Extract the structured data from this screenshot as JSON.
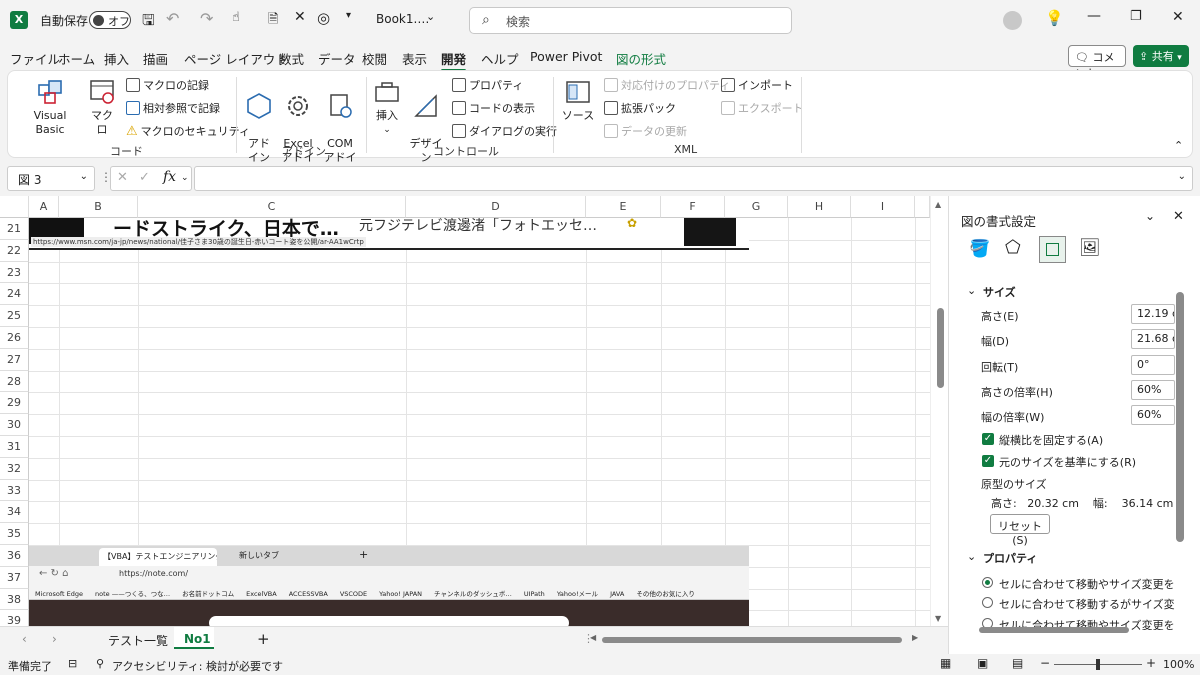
{
  "title_bar": {
    "autosave_label": "自動保存",
    "autosave_state": "オフ",
    "filename": "Book1.…",
    "search_placeholder": "検索"
  },
  "menu_tabs": [
    "ファイル",
    "ホーム",
    "挿入",
    "描画",
    "ページ レイアウト",
    "数式",
    "データ",
    "校閲",
    "表示",
    "開発",
    "ヘルプ",
    "Power Pivot",
    "図の形式"
  ],
  "active_tab": "開発",
  "comment_label": "コメント",
  "share_label": "共有",
  "ribbon": {
    "code": {
      "label": "コード",
      "visual_basic": "Visual Basic",
      "macro": "マクロ",
      "record_macro": "マクロの記録",
      "relative_ref": "相対参照で記録",
      "macro_security": "マクロのセキュリティ"
    },
    "addin": {
      "label": "アドイン",
      "addin": "アド\nイン",
      "excel_addin": "Excel\nアドイン",
      "com_addin": "COM\nアドイン"
    },
    "controls": {
      "label": "コントロール",
      "insert": "挿入",
      "design_mode": "デザイン\nモード",
      "properties": "プロパティ",
      "view_code": "コードの表示",
      "run_dialog": "ダイアログの実行"
    },
    "xml": {
      "label": "XML",
      "source": "ソース",
      "map_properties": "対応付けのプロパティ",
      "expansion_packs": "拡張パック",
      "refresh_data": "データの更新",
      "import": "インポート",
      "export": "エクスポート"
    }
  },
  "name_box": "図 3",
  "columns": [
    "A",
    "B",
    "C",
    "D",
    "E",
    "F",
    "G",
    "H",
    "I"
  ],
  "rows": [
    "21",
    "22",
    "23",
    "24",
    "25",
    "26",
    "27",
    "28",
    "29",
    "30",
    "31",
    "32",
    "33",
    "34",
    "35",
    "36",
    "37",
    "38",
    "39"
  ],
  "embedded_top": {
    "headline": "ードストライク、日本で…",
    "headline2": "元フジテレビ渡邊渚「フォトエッセ…",
    "url": "https://www.msn.com/ja-jp/news/national/佳子さま30歳の誕生日-赤いコート姿を公開/ar-AA1wCrtp"
  },
  "embedded_bottom": {
    "tab1": "【VBA】テストエンジニアリング】エビ",
    "tab2": "新しいタブ",
    "address": "https://note.com/",
    "bookmarks": [
      "Microsoft Edge",
      "note ——つくる、つな…",
      "お名前ドットコム",
      "ExcelVBA",
      "ACCESSVBA",
      "VSCODE",
      "Yahoo! JAPAN",
      "チャンネルのダッシュボ…",
      "UIPath",
      "Yahoo!メール",
      "JAVA",
      "その他のお気に入り"
    ]
  },
  "sheets": [
    "テスト一覧",
    "No1"
  ],
  "active_sheet": "No1",
  "status": {
    "ready": "準備完了",
    "accessibility": "アクセシビリティ: 検討が必要です",
    "zoom": "100%"
  },
  "pane": {
    "title": "図の書式設定",
    "size_section": "サイズ",
    "height_label": "高さ(E)",
    "height_value": "12.19 cm",
    "width_label": "幅(D)",
    "width_value": "21.68 cm",
    "rotation_label": "回転(T)",
    "rotation_value": "0°",
    "scale_h_label": "高さの倍率(H)",
    "scale_h_value": "60%",
    "scale_w_label": "幅の倍率(W)",
    "scale_w_value": "60%",
    "lock_aspect": "縦横比を固定する(A)",
    "relative_original": "元のサイズを基準にする(R)",
    "original_size_label": "原型のサイズ",
    "original_size_value": "高さ:   20.32 cm    幅:    36.14 cm",
    "reset_button": "リセット(S)",
    "properties_section": "プロパティ",
    "prop_opt1": "セルに合わせて移動やサイズ変更をする(S)",
    "prop_opt2": "セルに合わせて移動するがサイズ変更はしない",
    "prop_opt3": "セルに合わせて移動やサイズ変更をしない"
  }
}
